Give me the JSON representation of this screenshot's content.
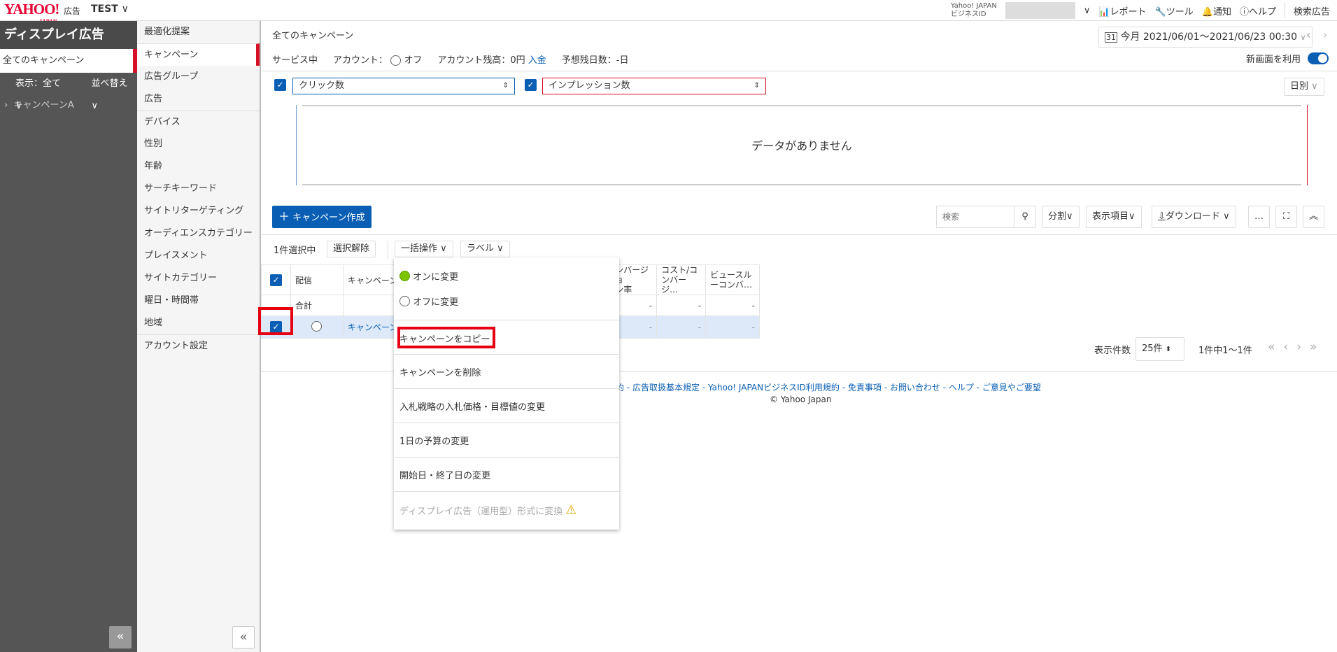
{
  "header": {
    "logo": "YAHOO!",
    "logo_sub": "JAPAN",
    "logo_ad": "広告",
    "account": "TEST",
    "bizid_line1": "Yahoo! JAPAN",
    "bizid_line2": "ビジネスID",
    "report": "レポート",
    "tools": "ツール",
    "notice": "通知",
    "help": "ヘルプ",
    "search_ads": "検索広告"
  },
  "sidebar": {
    "title": "ディスプレイ広告",
    "active": "全てのキャンペーン",
    "filter": "表示：全て",
    "sort": "並べ替え",
    "campaigns": [
      "キャンペーンA"
    ]
  },
  "nav": {
    "items": [
      "最適化提案",
      "キャンペーン",
      "広告グループ",
      "広告",
      "デバイス",
      "性別",
      "年齢",
      "サーチキーワード",
      "サイトリターゲティング",
      "オーディエンスカテゴリー",
      "プレイスメント",
      "サイトカテゴリー",
      "曜日・時間帯",
      "地域",
      "アカウント設定"
    ],
    "active": "キャンペーン"
  },
  "main": {
    "title": "全てのキャンペーン",
    "date_range": "今月 2021/06/01～2021/06/23 00:30",
    "status": "サービス中",
    "account_label": "アカウント：",
    "account_value": "オフ",
    "balance": "アカウント残高：0円",
    "deposit": "入金",
    "days_left": "予想残日数：-日",
    "new_ui": "新画面を利用",
    "new_ui_on": true
  },
  "chart": {
    "metric1": "クリック数",
    "metric2": "インプレッション数",
    "granularity": "日別",
    "empty": "データがありません",
    "color1": "#0a5fb4",
    "color2": "#d50f25"
  },
  "toolbar": {
    "create": "キャンペーン作成",
    "search_placeholder": "検索",
    "split": "分割",
    "columns": "表示項目",
    "download": "ダウンロード",
    "more": "…"
  },
  "selection": {
    "count": "1件選択中",
    "clear": "選択解除",
    "bulk": "一括操作",
    "label": "ラベル"
  },
  "table": {
    "headers": [
      "配信",
      "キャンペーン",
      "コンバージョン率",
      "コスト/コンバージョン…",
      "ビュースルーコンバ…"
    ],
    "header_partial": [
      "ンバージョ",
      "ン率",
      "コスト/コ",
      "ンバージ…",
      "ビュースル",
      "ーコンバ…"
    ],
    "total_label": "合計",
    "rows": [
      {
        "name": "キャンペーンA",
        "values": [
          "-",
          "-",
          "-"
        ]
      }
    ],
    "total_values": [
      "-",
      "-",
      "-"
    ]
  },
  "pagination": {
    "per_page_label": "表示件数",
    "per_page": "25件",
    "range": "1件中1～1件"
  },
  "menu": {
    "items": [
      "オンに変更",
      "オフに変更",
      "キャンペーンをコピー",
      "キャンペーンを削除",
      "入札戦略の入札価格・目標値の変更",
      "1日の予算の変更",
      "開始日・終了日の変更",
      "ディスプレイ広告（運用型）形式に変換"
    ]
  },
  "footer": {
    "links": [
      "約",
      "広告取扱基本規定",
      "Yahoo! JAPANビジネスID利用規約",
      "免責事項",
      "お問い合わせ",
      "ヘルプ",
      "ご意見やご要望"
    ],
    "copyright": "© Yahoo Japan"
  }
}
